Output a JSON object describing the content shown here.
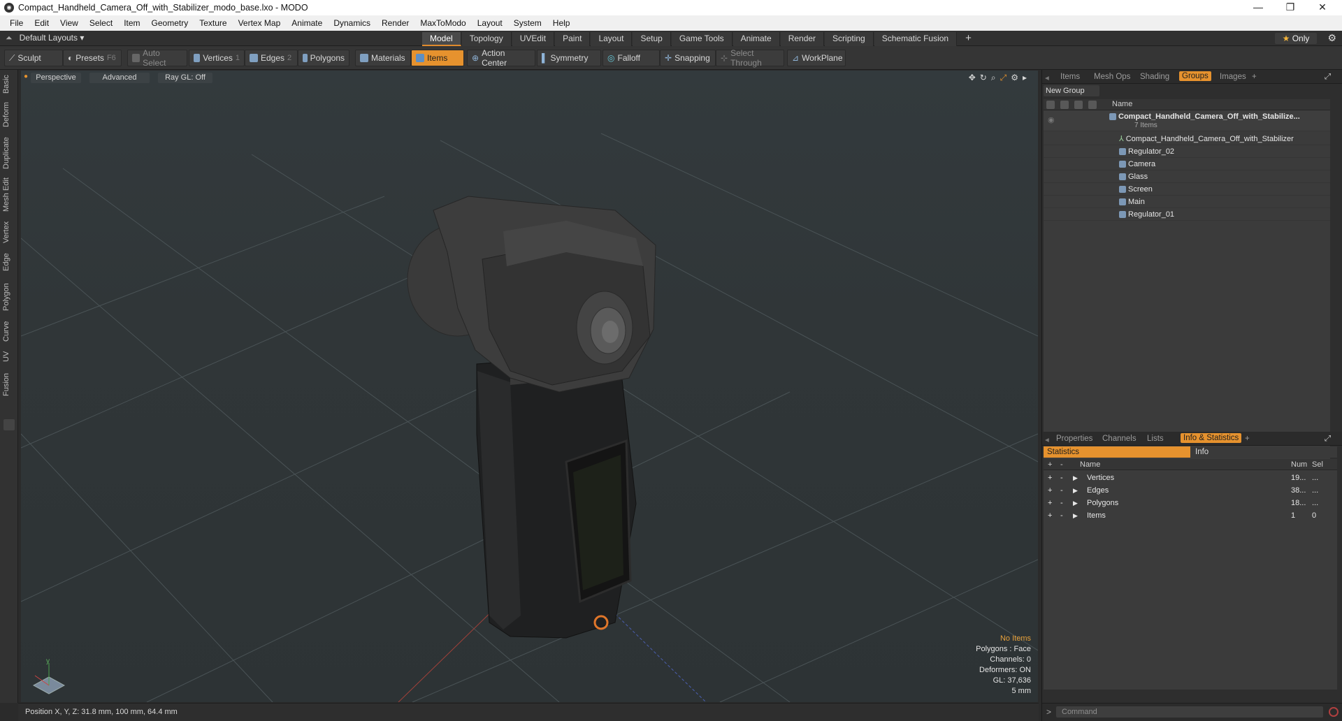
{
  "window": {
    "title": "Compact_Handheld_Camera_Off_with_Stabilizer_modo_base.lxo - MODO",
    "minimize": "—",
    "maximize": "❐",
    "close": "✕"
  },
  "menu": [
    "File",
    "Edit",
    "View",
    "Select",
    "Item",
    "Geometry",
    "Texture",
    "Vertex Map",
    "Animate",
    "Dynamics",
    "Render",
    "MaxToModo",
    "Layout",
    "System",
    "Help"
  ],
  "modebar": {
    "layouts": "Default Layouts ▾",
    "tabs": [
      "Model",
      "Topology",
      "UVEdit",
      "Paint",
      "Layout",
      "Setup",
      "Game Tools",
      "Animate",
      "Render",
      "Scripting",
      "Schematic Fusion"
    ],
    "active_tab": "Model",
    "add": "+",
    "only": "Only",
    "gear": "⚙"
  },
  "toolbar": {
    "sculpt": "Sculpt",
    "presets": "Presets",
    "presets_key": "F6",
    "auto_select": "Auto Select",
    "vertices": "Vertices",
    "vertices_key": "1",
    "edges": "Edges",
    "edges_key": "2",
    "polygons": "Polygons",
    "materials": "Materials",
    "items": "Items",
    "action_center": "Action Center",
    "symmetry": "Symmetry",
    "falloff": "Falloff",
    "snapping": "Snapping",
    "select_through": "Select Through",
    "workplane": "WorkPlane"
  },
  "left_tabs": [
    "Basic",
    "Deform",
    "Duplicate",
    "Mesh Edit",
    "Vertex",
    "Edge",
    "Polygon",
    "Curve",
    "UV",
    "Fusion"
  ],
  "viewport": {
    "view": "Perspective",
    "shading": "Advanced",
    "raygl": "Ray GL: Off",
    "stats": {
      "selection": "No Items",
      "polygons": "Polygons : Face",
      "channels": "Channels: 0",
      "deformers": "Deformers: ON",
      "gl": "GL: 37,636",
      "scale": "5 mm"
    }
  },
  "status": {
    "position": "Position X, Y, Z:  31.8 mm, 100 mm, 64.4 mm"
  },
  "right_panel": {
    "top_tabs": [
      "Items",
      "Mesh Ops",
      "Shading",
      "Groups",
      "Images"
    ],
    "active_top_tab": "Groups",
    "new_group": "New Group",
    "name_header": "Name",
    "group_root": "Compact_Handheld_Camera_Off_with_Stabilize...",
    "group_count": "7 Items",
    "group_items": [
      "Compact_Handheld_Camera_Off_with_Stabilizer",
      "Regulator_02",
      "Camera",
      "Glass",
      "Screen",
      "Main",
      "Regulator_01"
    ],
    "bottom_tabs": [
      "Properties",
      "Channels",
      "Lists",
      "Info & Statistics"
    ],
    "active_bottom_tab": "Info & Statistics",
    "statistics_label": "Statistics",
    "info_label": "Info",
    "stats_headers": {
      "name": "Name",
      "num": "Num",
      "sel": "Sel"
    },
    "stats_rows": [
      {
        "name": "Vertices",
        "num": "19...",
        "sel": "..."
      },
      {
        "name": "Edges",
        "num": "38...",
        "sel": "..."
      },
      {
        "name": "Polygons",
        "num": "18...",
        "sel": "..."
      },
      {
        "name": "Items",
        "num": "1",
        "sel": "0"
      }
    ],
    "command_placeholder": "Command"
  },
  "colors": {
    "accent": "#e6922e",
    "viewport_bg": "#303638"
  }
}
